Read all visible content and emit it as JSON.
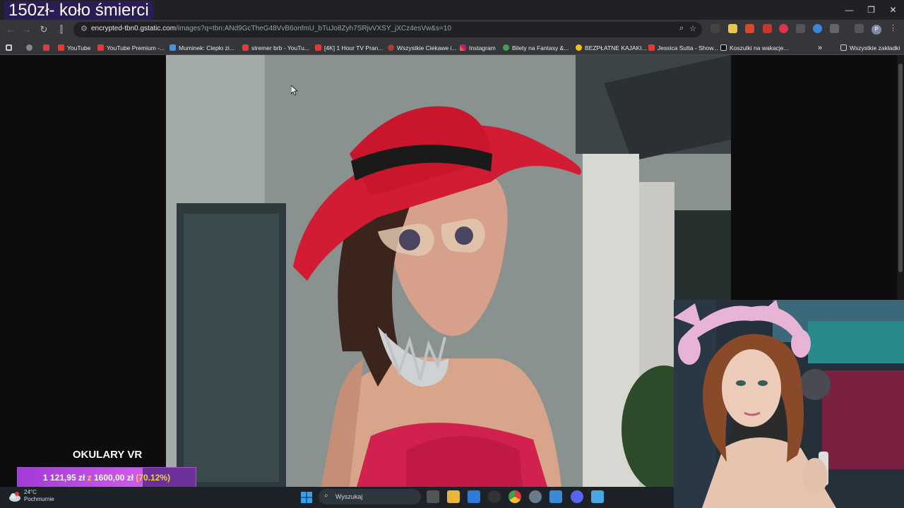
{
  "overlay": {
    "stream_title": "150zł- koło śmierci"
  },
  "window": {
    "minimize": "—",
    "restore": "❐",
    "close": "✕"
  },
  "browser": {
    "url_host": "encrypted-tbn0.gstatic.com",
    "url_path": "/images?q=tbn:ANd9GcTheG48VvB6onfmU_bTuJo8Zyh7SRjvVXSY_jXCz4esVw&s=10",
    "profile_initial": "P",
    "nav": {
      "back": "←",
      "forward": "→",
      "reload": "↻",
      "split": "⫿"
    }
  },
  "bookmarks": [
    {
      "label": "",
      "icon": "grid-icon"
    },
    {
      "label": "",
      "icon": "generic-icon"
    },
    {
      "label": "",
      "icon": "youtube-icon"
    },
    {
      "label": "YouTube",
      "icon": "youtube-icon"
    },
    {
      "label": "YouTube Premium -...",
      "icon": "youtube-icon"
    },
    {
      "label": "Muminek: Ciepło zi...",
      "icon": "check-icon"
    },
    {
      "label": "stremer brb - YouTu...",
      "icon": "youtube-icon"
    },
    {
      "label": "[4K] 1 Hour TV Pran...",
      "icon": "youtube-icon"
    },
    {
      "label": "Wszystkie Ciekawe i...",
      "icon": "generic-icon"
    },
    {
      "label": "Instagram",
      "icon": "instagram-icon"
    },
    {
      "label": "Bilety na Fantasy &...",
      "icon": "generic-icon"
    },
    {
      "label": "BEZPŁATNE KAJAKI...",
      "icon": "generic-icon"
    },
    {
      "label": "Jessica Sutta - Show...",
      "icon": "youtube-icon"
    },
    {
      "label": "Koszulki na wakacje...",
      "icon": "tiktok-icon"
    },
    {
      "label": "»",
      "icon": "more-icon"
    },
    {
      "label": "Wszystkie zakładki",
      "icon": "folder-icon"
    }
  ],
  "goal": {
    "title": "OKULARY VR",
    "current": "1 121,95 zł",
    "sep": "z",
    "target": "1600,00 zł",
    "percent_text": "(70.12%)",
    "progress": 0.7012
  },
  "taskbar": {
    "temperature": "24°C",
    "weather": "Pochmurnie",
    "search_placeholder": "Wyszukaj"
  },
  "colors": {
    "accent": "#6d2f9a",
    "progress": "#cf5be8",
    "percent": "#f3d23a"
  }
}
